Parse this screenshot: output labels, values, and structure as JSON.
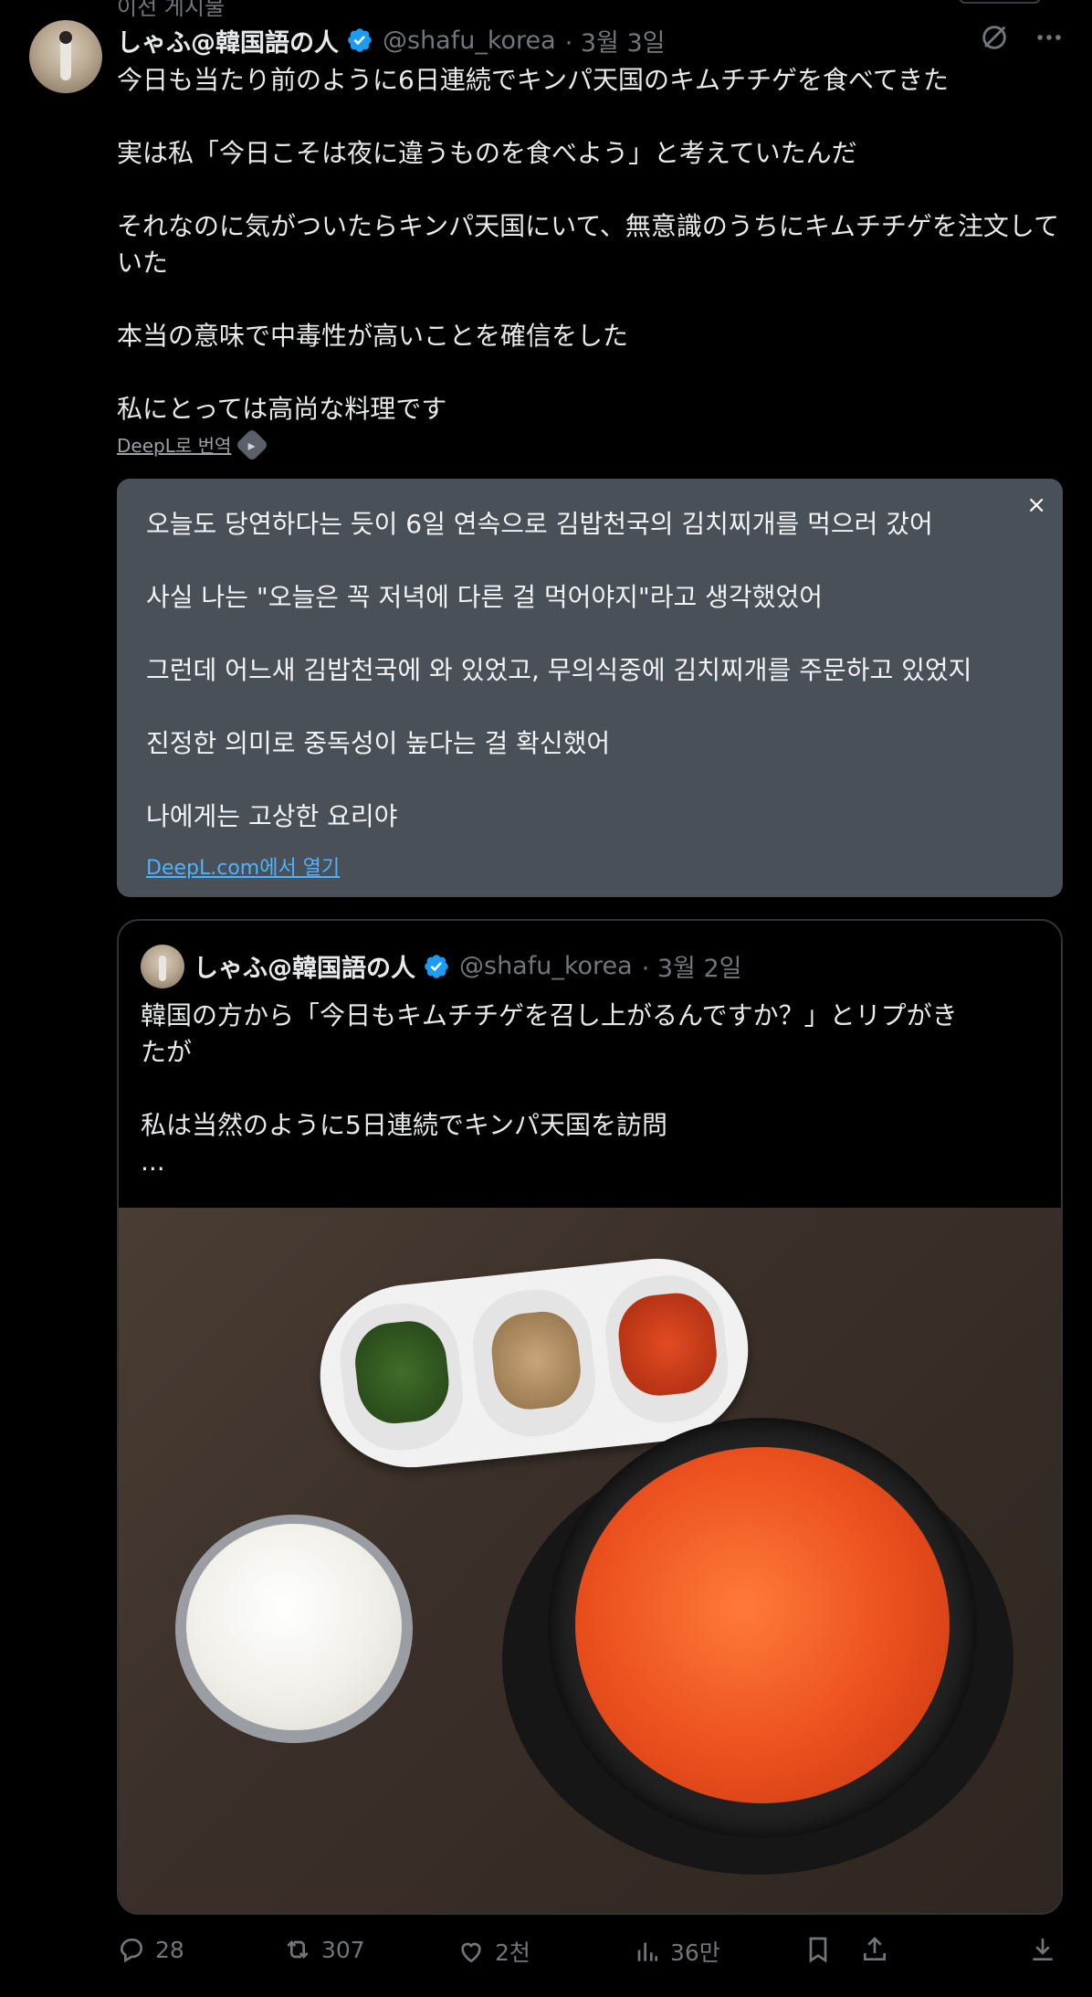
{
  "top_fragment": "이전 게시물",
  "tweet": {
    "author_name": "しゃふ@韓国語の人",
    "handle": "@shafu_korea",
    "date": "· 3월 3일",
    "paragraphs": [
      "今日も当たり前のように6日連続でキンパ天国のキムチチゲを食べてきた",
      "実は私「今日こそは夜に違うものを食べよう」と考えていたんだ",
      "それなのに気がついたらキンパ天国にいて、無意識のうちにキムチチゲを注文していた",
      "本当の意味で中毒性が高いことを確信をした",
      "私にとっては高尚な料理です"
    ],
    "translate_link": "DeepL로 번역"
  },
  "translation": {
    "paragraphs": [
      "오늘도 당연하다는 듯이 6일 연속으로 김밥천국의 김치찌개를 먹으러 갔어",
      "사실 나는 \"오늘은 꼭 저녁에 다른 걸 먹어야지\"라고 생각했었어",
      "그런데 어느새 김밥천국에 와 있었고, 무의식중에 김치찌개를 주문하고 있었지",
      "진정한 의미로 중독성이 높다는 걸 확신했어",
      "나에게는 고상한 요리야"
    ],
    "close": "×",
    "open_link": "DeepL.com에서 열기"
  },
  "quote": {
    "author_name": "しゃふ@韓国語の人",
    "handle": "@shafu_korea",
    "date": "· 3월 2일",
    "lines": [
      "韓国の方から「今日もキムチチゲを召し上がるんですか？」とリプがき",
      "たが",
      "",
      "私は当然のように5日連続でキンパ天国を訪問",
      "..."
    ]
  },
  "actions": {
    "replies": "28",
    "retweets": "307",
    "likes": "2천",
    "views": "36만"
  }
}
